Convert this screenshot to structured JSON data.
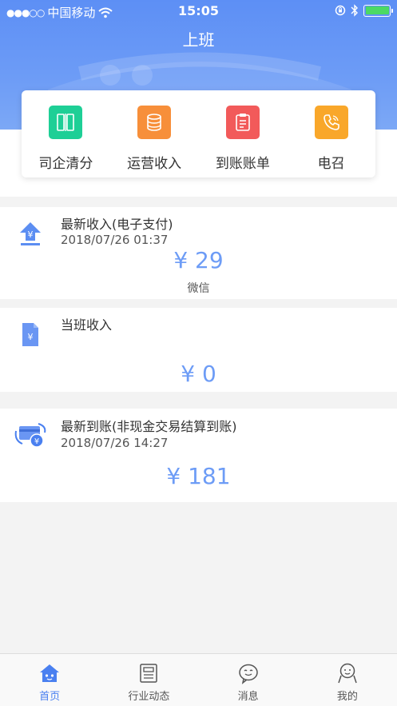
{
  "status_bar": {
    "signal_dots": "●●●○○",
    "carrier": "中国移动",
    "time": "15:05",
    "wifi_icon": "wifi-icon",
    "battery_color": "#4cd964"
  },
  "header": {
    "title": "上班",
    "bg_color": "#6d9cf6"
  },
  "quick_actions": [
    {
      "label": "司企清分",
      "icon": "split-icon",
      "color": "#1ecf96"
    },
    {
      "label": "运营收入",
      "icon": "coins-icon",
      "color": "#f78f3a"
    },
    {
      "label": "到账账单",
      "icon": "clipboard-icon",
      "color": "#f25a5a"
    },
    {
      "label": "电召",
      "icon": "phone-icon",
      "color": "#f9a72a"
    }
  ],
  "cards": {
    "latest_income": {
      "title": "最新收入(电子支付)",
      "date": "2018/07/26 01:37",
      "amount": "¥ 29",
      "method": "微信"
    },
    "shift_income": {
      "title": "当班收入",
      "amount": "¥ 0"
    },
    "latest_arrival": {
      "title": "最新到账(非现金交易结算到账)",
      "date": "2018/07/26 14:27",
      "amount": "¥ 181"
    }
  },
  "tabbar": {
    "active": "首页",
    "items": [
      {
        "label": "首页",
        "icon": "home-icon"
      },
      {
        "label": "行业动态",
        "icon": "news-icon"
      },
      {
        "label": "消息",
        "icon": "message-icon"
      },
      {
        "label": "我的",
        "icon": "profile-icon"
      }
    ]
  },
  "accent_color": "#6d9cf6"
}
